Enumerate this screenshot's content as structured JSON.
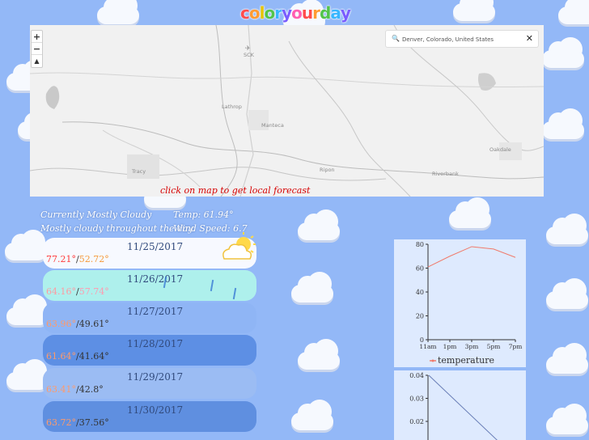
{
  "logo": "coloryourday",
  "logo_colors": [
    "#ff4d4d",
    "#ff9b33",
    "#e6c400",
    "#52c44b",
    "#38b6ff",
    "#7a5cff",
    "#ff5fb2",
    "#ff4d4d",
    "#ff9b33",
    "#52c44b",
    "#38b6ff",
    "#7a5cff"
  ],
  "map": {
    "search_value": "Denver, Colorado, United States",
    "zoom_in": "+",
    "zoom_out": "−",
    "north": "▲",
    "places": [
      {
        "label": "SCK"
      },
      {
        "label": "Lathrop"
      },
      {
        "label": "Manteca"
      },
      {
        "label": "Tracy"
      },
      {
        "label": "Ripon"
      },
      {
        "label": "Oakdale"
      },
      {
        "label": "Riverbank"
      }
    ],
    "hint": "click on map to get local forecast"
  },
  "current": {
    "summary": "Currently Mostly Cloudy",
    "description": "Mostly cloudy throughout the day.",
    "temp": "Temp: 61.94°",
    "wind": "Wind Speed: 6.7"
  },
  "forecast": [
    {
      "date": "11/25/2017",
      "high": "77.21°",
      "low": "52.72°",
      "bg": "#f7f9ff"
    },
    {
      "date": "11/26/2017",
      "high": "64.16°",
      "low": "57.74°",
      "bg": "#aef0ec"
    },
    {
      "date": "11/27/2017",
      "high": "63.96°",
      "low": "49.61°",
      "bg": "#8fb5f5"
    },
    {
      "date": "11/28/2017",
      "high": "61.64°",
      "low": "41.64°",
      "bg": "#5d8fe4"
    },
    {
      "date": "11/29/2017",
      "high": "63.41°",
      "low": "42.8°",
      "bg": "#9bbcf3"
    },
    {
      "date": "11/30/2017",
      "high": "63.72°",
      "low": "37.56°",
      "bg": "#5f8fe0"
    }
  ],
  "chart_data": [
    {
      "type": "line",
      "x": [
        "11am",
        "1pm",
        "3pm",
        "5pm",
        "7pm"
      ],
      "series": [
        {
          "name": "temperature",
          "values": [
            61,
            70,
            78,
            76,
            69
          ],
          "color": "#f07a6a"
        }
      ],
      "yticks": [
        0,
        20,
        40,
        60,
        80
      ],
      "ylim": [
        0,
        80
      ],
      "legend": "bottom"
    },
    {
      "type": "line",
      "series": [
        {
          "values": [
            0.04,
            0.03,
            0.02,
            0.01
          ]
        }
      ],
      "yticks": [
        "0.04",
        "0.03",
        "0.02"
      ],
      "ylim": [
        0,
        0.04
      ]
    }
  ]
}
